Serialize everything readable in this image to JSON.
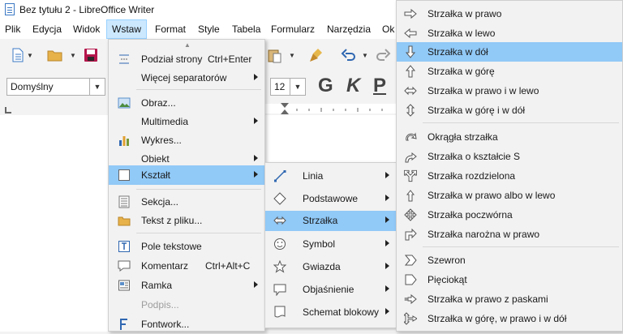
{
  "window": {
    "title": "Bez tytułu 2 - LibreOffice Writer"
  },
  "menubar": [
    "Plik",
    "Edycja",
    "Widok",
    "Wstaw",
    "Format",
    "Style",
    "Tabela",
    "Formularz",
    "Narzędzia",
    "Ok"
  ],
  "toolbar": {
    "paragraph_style": "Domyślny",
    "font_size": "12",
    "bold": "G",
    "italic": "K",
    "underline": "P"
  },
  "wstaw_menu": [
    {
      "label": "Podział strony",
      "shortcut": "Ctrl+Enter",
      "icon": "page-break-icon"
    },
    {
      "label": "Więcej separatorów",
      "submenu": true
    },
    {
      "label": "Obraz...",
      "icon": "image-icon"
    },
    {
      "label": "Multimedia",
      "submenu": true
    },
    {
      "label": "Wykres...",
      "icon": "chart-icon"
    },
    {
      "label": "Obiekt",
      "submenu": true
    },
    {
      "label": "Kształt",
      "submenu": true,
      "highlighted": true,
      "icon": "shape-icon"
    },
    {
      "label": "Sekcja...",
      "icon": "section-icon"
    },
    {
      "label": "Tekst z pliku...",
      "icon": "folder-icon"
    },
    {
      "label": "Pole tekstowe",
      "icon": "text-box-icon"
    },
    {
      "label": "Komentarz",
      "shortcut": "Ctrl+Alt+C",
      "icon": "comment-icon"
    },
    {
      "label": "Ramka",
      "submenu": true,
      "icon": "frame-icon"
    },
    {
      "label": "Podpis...",
      "disabled": true
    },
    {
      "label": "Fontwork...",
      "icon": "fontwork-icon"
    }
  ],
  "ksztalt_menu": [
    {
      "label": "Linia",
      "icon": "line-icon"
    },
    {
      "label": "Podstawowe",
      "icon": "diamond-icon"
    },
    {
      "label": "Strzałka",
      "icon": "double-arrow-icon",
      "highlighted": true
    },
    {
      "label": "Symbol",
      "icon": "smiley-icon"
    },
    {
      "label": "Gwiazda",
      "icon": "star-icon"
    },
    {
      "label": "Objaśnienie",
      "icon": "callout-icon"
    },
    {
      "label": "Schemat blokowy",
      "icon": "flowchart-icon"
    }
  ],
  "strzalka_menu": [
    {
      "label": "Strzałka w prawo",
      "icon": "arrow-right-icon"
    },
    {
      "label": "Strzałka w lewo",
      "icon": "arrow-left-icon"
    },
    {
      "label": "Strzałka w dół",
      "icon": "arrow-down-icon",
      "highlighted": true
    },
    {
      "label": "Strzałka w górę",
      "icon": "arrow-up-icon"
    },
    {
      "label": "Strzałka w prawo i w lewo",
      "icon": "arrow-left-right-icon"
    },
    {
      "label": "Strzałka w górę i w dół",
      "icon": "arrow-up-down-icon"
    },
    {
      "label": "Okrągła strzałka",
      "icon": "circular-arrow-icon"
    },
    {
      "label": "Strzałka o kształcie S",
      "icon": "s-arrow-icon"
    },
    {
      "label": "Strzałka rozdzielona",
      "icon": "split-arrow-icon"
    },
    {
      "label": "Strzałka w prawo albo w lewo",
      "icon": "right-or-left-arrow-icon"
    },
    {
      "label": "Strzałka poczwórna",
      "icon": "quad-arrow-icon"
    },
    {
      "label": "Strzałka narożna w prawo",
      "icon": "corner-right-arrow-icon"
    },
    {
      "label": "Szewron",
      "icon": "chevron-icon"
    },
    {
      "label": "Pięciokąt",
      "icon": "pentagon-icon"
    },
    {
      "label": "Strzałka w prawo z paskami",
      "icon": "striped-right-arrow-icon"
    },
    {
      "label": "Strzałka w górę, w prawo i w dół",
      "icon": "up-right-down-arrow-icon"
    }
  ]
}
